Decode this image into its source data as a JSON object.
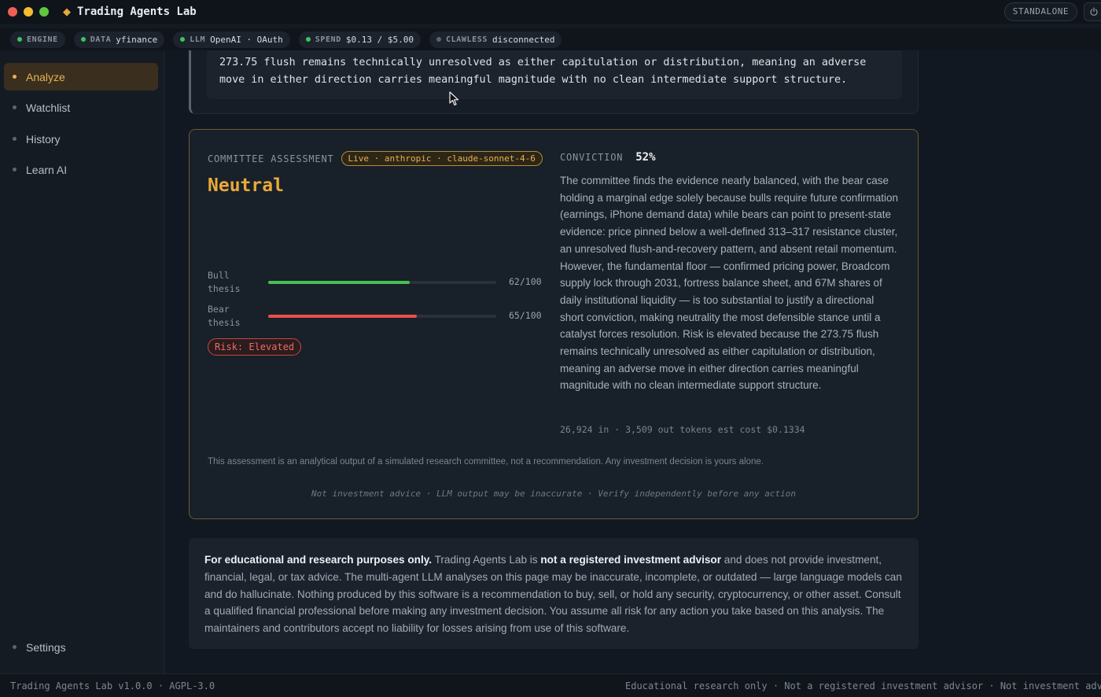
{
  "window": {
    "title": "Trading Agents Lab",
    "mode_badge": "STANDALONE"
  },
  "status": [
    {
      "key": "ENGINE",
      "value": "",
      "state": "ok"
    },
    {
      "key": "DATA",
      "value": "yfinance",
      "state": "ok"
    },
    {
      "key": "LLM",
      "value": "OpenAI · OAuth",
      "state": "ok"
    },
    {
      "key": "SPEND",
      "value": "$0.13 / $5.00",
      "state": "ok"
    },
    {
      "key": "CLAWLESS",
      "value": "disconnected",
      "state": "off"
    }
  ],
  "sidebar": {
    "items": [
      {
        "label": "Analyze",
        "active": true
      },
      {
        "label": "Watchlist"
      },
      {
        "label": "History"
      },
      {
        "label": "Learn AI"
      }
    ],
    "settings_label": "Settings"
  },
  "previous_card": {
    "text": "273.75 flush remains technically unresolved as either capitulation or distribution, meaning an adverse move in either direction carries meaningful magnitude with no clean intermediate support structure."
  },
  "assessment": {
    "label": "COMMITTEE ASSESSMENT",
    "model_badge": "Live · anthropic · claude-sonnet-4-6",
    "verdict": "Neutral",
    "bull": {
      "label": "Bull thesis",
      "score": 62,
      "display": "62/100"
    },
    "bear": {
      "label": "Bear thesis",
      "score": 65,
      "display": "65/100"
    },
    "risk": "Risk: Elevated",
    "conviction_label": "CONVICTION",
    "conviction_value": "52%",
    "rationale": "The committee finds the evidence nearly balanced, with the bear case holding a marginal edge solely because bulls require future confirmation (earnings, iPhone demand data) while bears can point to present-state evidence: price pinned below a well-defined 313–317 resistance cluster, an unresolved flush-and-recovery pattern, and absent retail momentum. However, the fundamental floor — confirmed pricing power, Broadcom supply lock through 2031, fortress balance sheet, and 67M shares of daily institutional liquidity — is too substantial to justify a directional short conviction, making neutrality the most defensible stance until a catalyst forces resolution. Risk is elevated because the 273.75 flush remains technically unresolved as either capitulation or distribution, meaning an adverse move in either direction carries meaningful magnitude with no clean intermediate support structure.",
    "tokens": "26,924 in · 3,509 out tokens  est cost $0.1334",
    "disclaimer": "This assessment is an analytical output of a simulated research committee, not a recommendation. Any investment decision is yours alone.",
    "footnote": "Not investment advice · LLM output may be inaccurate · Verify independently before any action"
  },
  "education": {
    "bold1": "For educational and research purposes only.",
    "text1": " Trading Agents Lab is ",
    "bold2": "not a registered investment advisor",
    "text2": " and does not provide investment, financial, legal, or tax advice. The multi-agent LLM analyses on this page may be inaccurate, incomplete, or outdated — large language models can and do hallucinate. Nothing produced by this software is a recommendation to buy, sell, or hold any security, cryptocurrency, or other asset. Consult a qualified financial professional before making any investment decision. You assume all risk for any action you take based on this analysis. The maintainers and contributors accept no liability for losses arising from use of this software."
  },
  "footer": {
    "left": "Trading Agents Lab v1.0.0 · AGPL-3.0",
    "right": "Educational research only · Not a registered investment advisor · Not investment advice"
  },
  "colors": {
    "accent": "#e9b052",
    "bull": "#45c151",
    "bear": "#ec4f48",
    "ok": "#3cc35c"
  }
}
